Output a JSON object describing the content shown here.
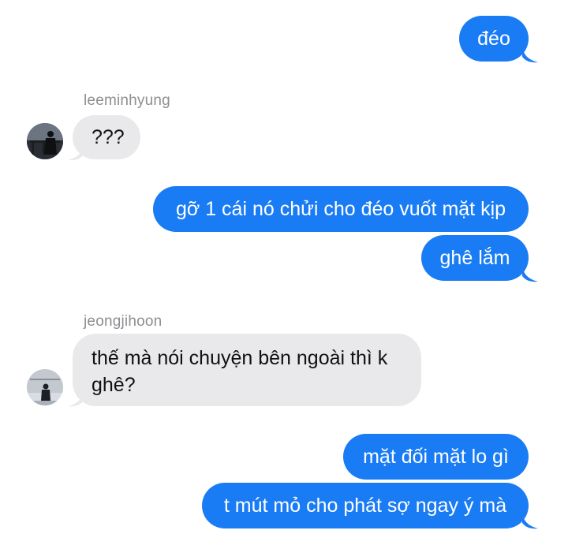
{
  "conversation": {
    "messages": [
      {
        "type": "sent",
        "text": "đéo"
      },
      {
        "type": "received",
        "sender": "leeminhyung",
        "text": "???"
      },
      {
        "type": "sent",
        "text": "gỡ 1 cái nó chửi cho đéo vuốt mặt kịp"
      },
      {
        "type": "sent",
        "text": "ghê lắm"
      },
      {
        "type": "received",
        "sender": "jeongjihoon",
        "text": "thế mà nói chuyện bên ngoài thì k ghê?"
      },
      {
        "type": "sent",
        "text": "mặt đối mặt lo gì"
      },
      {
        "type": "sent",
        "text": "t mút mỏ cho phát sợ ngay ý mà"
      }
    ]
  },
  "colors": {
    "sent_bubble": "#1a7cf4",
    "received_bubble": "#e9e9eb",
    "sender_name": "#8e8e93"
  }
}
